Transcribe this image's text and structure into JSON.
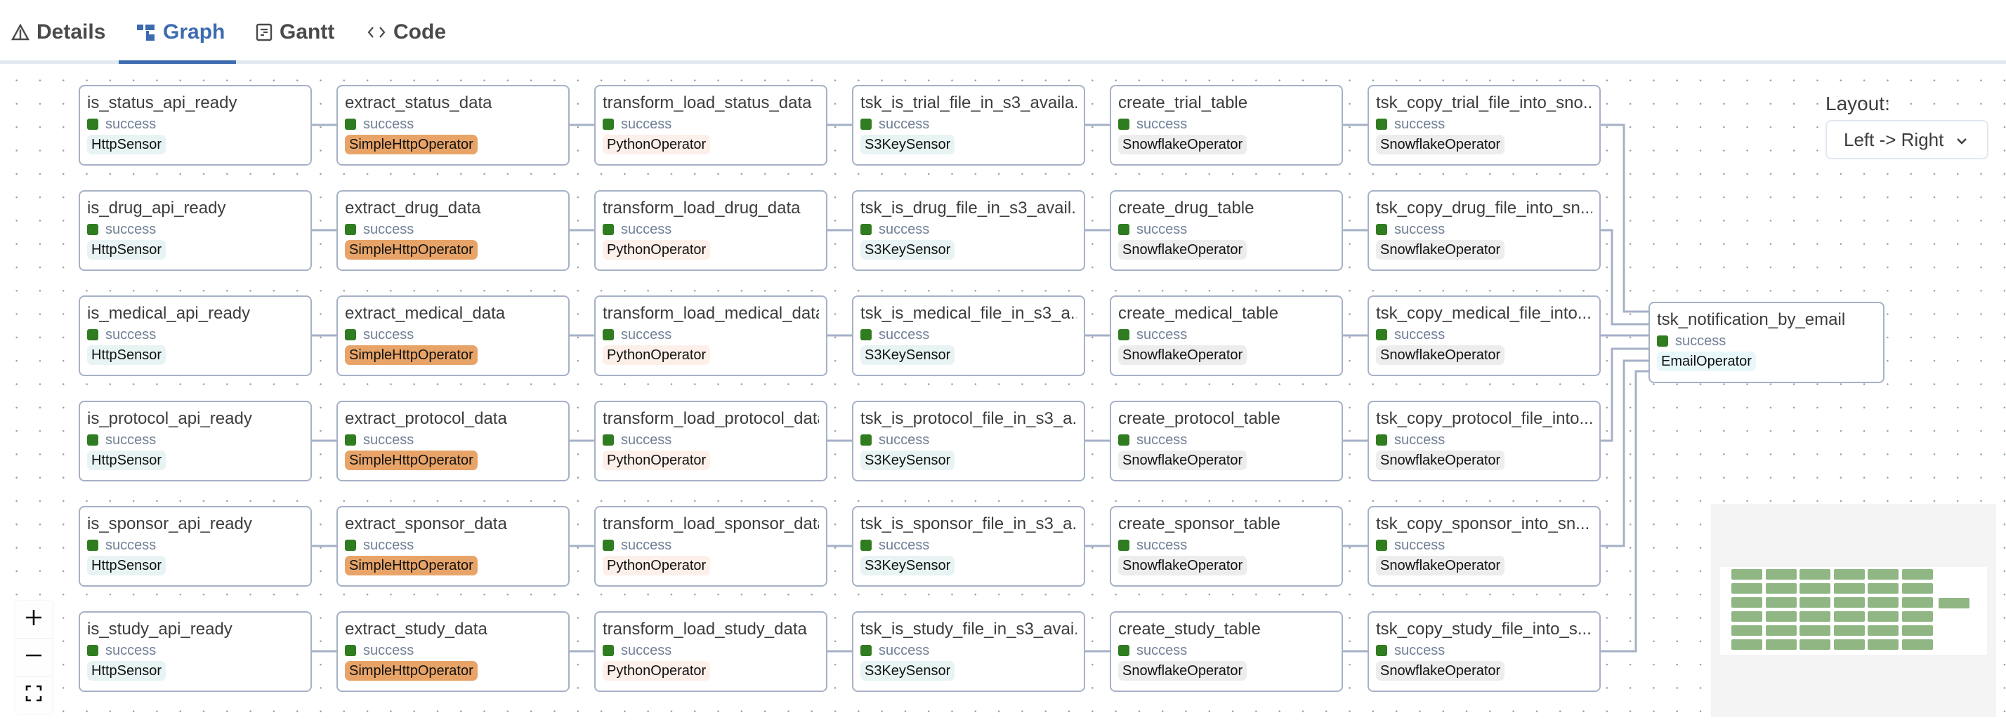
{
  "tabs": [
    {
      "label": "Details",
      "icon": "warning-triangle-icon",
      "active": false
    },
    {
      "label": "Graph",
      "icon": "graph-icon",
      "active": true
    },
    {
      "label": "Gantt",
      "icon": "gantt-icon",
      "active": false
    },
    {
      "label": "Code",
      "icon": "code-icon",
      "active": false
    }
  ],
  "layout": {
    "label": "Layout:",
    "selected": "Left -> Right"
  },
  "operator_colors": {
    "HttpSensor": "#e8f3f4",
    "SimpleHttpOperator": "#e8a468",
    "PythonOperator": "#fdefe9",
    "S3KeySensor": "#e8f3f4",
    "SnowflakeOperator": "#ededed",
    "EmailOperator": "#e8f7fa"
  },
  "status_color": "#2f7d20",
  "rows": [
    [
      {
        "title": "is_status_api_ready",
        "status": "success",
        "operator": "HttpSensor"
      },
      {
        "title": "extract_status_data",
        "status": "success",
        "operator": "SimpleHttpOperator"
      },
      {
        "title": "transform_load_status_data",
        "status": "success",
        "operator": "PythonOperator"
      },
      {
        "title": "tsk_is_trial_file_in_s3_availa...",
        "status": "success",
        "operator": "S3KeySensor"
      },
      {
        "title": "create_trial_table",
        "status": "success",
        "operator": "SnowflakeOperator"
      },
      {
        "title": "tsk_copy_trial_file_into_sno...",
        "status": "success",
        "operator": "SnowflakeOperator"
      }
    ],
    [
      {
        "title": "is_drug_api_ready",
        "status": "success",
        "operator": "HttpSensor"
      },
      {
        "title": "extract_drug_data",
        "status": "success",
        "operator": "SimpleHttpOperator"
      },
      {
        "title": "transform_load_drug_data",
        "status": "success",
        "operator": "PythonOperator"
      },
      {
        "title": "tsk_is_drug_file_in_s3_avail...",
        "status": "success",
        "operator": "S3KeySensor"
      },
      {
        "title": "create_drug_table",
        "status": "success",
        "operator": "SnowflakeOperator"
      },
      {
        "title": "tsk_copy_drug_file_into_sn...",
        "status": "success",
        "operator": "SnowflakeOperator"
      }
    ],
    [
      {
        "title": "is_medical_api_ready",
        "status": "success",
        "operator": "HttpSensor"
      },
      {
        "title": "extract_medical_data",
        "status": "success",
        "operator": "SimpleHttpOperator"
      },
      {
        "title": "transform_load_medical_data",
        "status": "success",
        "operator": "PythonOperator"
      },
      {
        "title": "tsk_is_medical_file_in_s3_a...",
        "status": "success",
        "operator": "S3KeySensor"
      },
      {
        "title": "create_medical_table",
        "status": "success",
        "operator": "SnowflakeOperator"
      },
      {
        "title": "tsk_copy_medical_file_into...",
        "status": "success",
        "operator": "SnowflakeOperator"
      }
    ],
    [
      {
        "title": "is_protocol_api_ready",
        "status": "success",
        "operator": "HttpSensor"
      },
      {
        "title": "extract_protocol_data",
        "status": "success",
        "operator": "SimpleHttpOperator"
      },
      {
        "title": "transform_load_protocol_data",
        "status": "success",
        "operator": "PythonOperator"
      },
      {
        "title": "tsk_is_protocol_file_in_s3_a...",
        "status": "success",
        "operator": "S3KeySensor"
      },
      {
        "title": "create_protocol_table",
        "status": "success",
        "operator": "SnowflakeOperator"
      },
      {
        "title": "tsk_copy_protocol_file_into...",
        "status": "success",
        "operator": "SnowflakeOperator"
      }
    ],
    [
      {
        "title": "is_sponsor_api_ready",
        "status": "success",
        "operator": "HttpSensor"
      },
      {
        "title": "extract_sponsor_data",
        "status": "success",
        "operator": "SimpleHttpOperator"
      },
      {
        "title": "transform_load_sponsor_data",
        "status": "success",
        "operator": "PythonOperator"
      },
      {
        "title": "tsk_is_sponsor_file_in_s3_a...",
        "status": "success",
        "operator": "S3KeySensor"
      },
      {
        "title": "create_sponsor_table",
        "status": "success",
        "operator": "SnowflakeOperator"
      },
      {
        "title": "tsk_copy_sponsor_into_sn...",
        "status": "success",
        "operator": "SnowflakeOperator"
      }
    ],
    [
      {
        "title": "is_study_api_ready",
        "status": "success",
        "operator": "HttpSensor"
      },
      {
        "title": "extract_study_data",
        "status": "success",
        "operator": "SimpleHttpOperator"
      },
      {
        "title": "transform_load_study_data",
        "status": "success",
        "operator": "PythonOperator"
      },
      {
        "title": "tsk_is_study_file_in_s3_avai...",
        "status": "success",
        "operator": "S3KeySensor"
      },
      {
        "title": "create_study_table",
        "status": "success",
        "operator": "SnowflakeOperator"
      },
      {
        "title": "tsk_copy_study_file_into_s...",
        "status": "success",
        "operator": "SnowflakeOperator"
      }
    ]
  ],
  "final_node": {
    "title": "tsk_notification_by_email",
    "status": "success",
    "operator": "EmailOperator"
  },
  "controls": {
    "zoom_in": "zoom-in",
    "zoom_out": "zoom-out",
    "fit_view": "fit-view"
  }
}
